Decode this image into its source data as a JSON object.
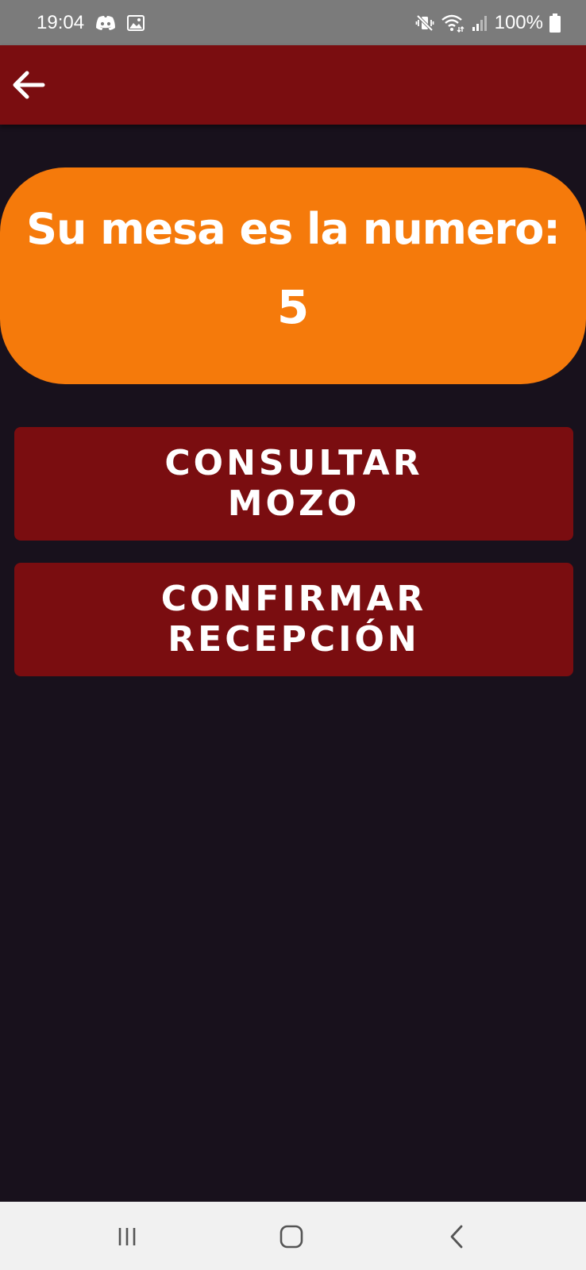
{
  "status_bar": {
    "time": "19:04",
    "battery": "100%",
    "icons": [
      "discord-icon",
      "gallery-icon",
      "vibrate-mute-icon",
      "wifi-icon",
      "signal-icon",
      "battery-icon"
    ]
  },
  "app_bar": {
    "back_icon": "arrow-back-icon"
  },
  "banner": {
    "title": "Su mesa es la numero:",
    "table_number": "5"
  },
  "buttons": {
    "consultar_label": "CONSULTAR MOZO",
    "confirmar_label": "CONFIRMAR RECEPCIÓN"
  },
  "nav_bar": {
    "icons": [
      "recent-apps-icon",
      "home-icon",
      "nav-back-icon"
    ]
  },
  "colors": {
    "status_bar": "#7b7b7b",
    "app_bar": "#7a0d10",
    "background": "#18111c",
    "banner": "#f57a0b",
    "button": "#7a0d10",
    "nav_bar": "#f1f1f1",
    "text": "#ffffff"
  }
}
